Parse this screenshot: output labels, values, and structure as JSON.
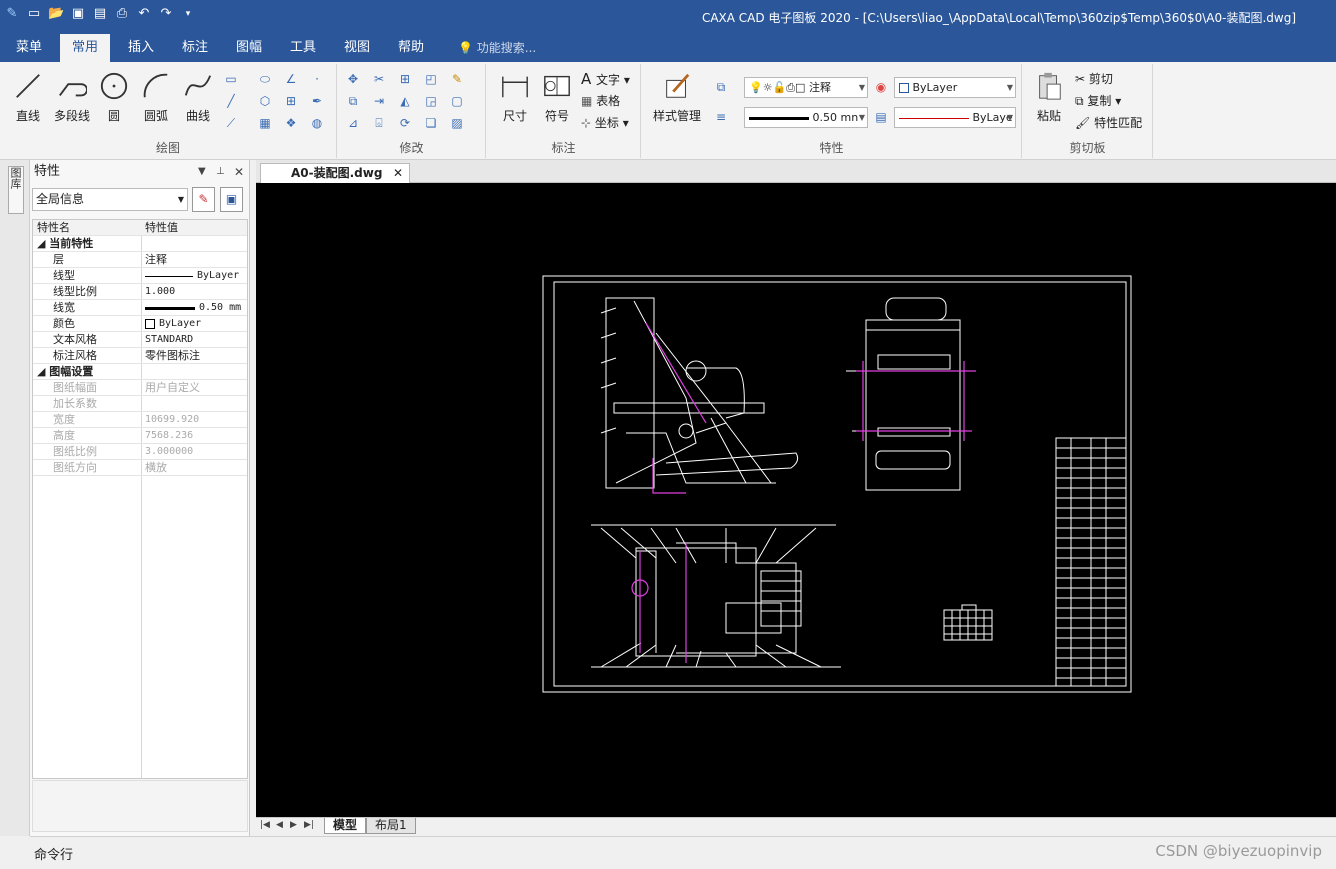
{
  "app": {
    "title": "CAXA CAD 电子图板 2020 - [C:\\Users\\liao_\\AppData\\Local\\Temp\\360zip$Temp\\360$0\\A0-装配图.dwg]"
  },
  "menu": {
    "tabs": [
      "菜单",
      "常用",
      "插入",
      "标注",
      "图幅",
      "工具",
      "视图",
      "帮助"
    ],
    "active": "常用",
    "search_placeholder": "功能搜索..."
  },
  "ribbon": {
    "draw": {
      "label": "绘图",
      "line": "直线",
      "polyline": "多段线",
      "circle": "圆",
      "arc": "圆弧",
      "curve": "曲线"
    },
    "modify": {
      "label": "修改"
    },
    "annotate": {
      "label": "标注",
      "dimension": "尺寸",
      "symbol": "符号",
      "text": "文字",
      "table": "表格",
      "coord": "坐标"
    },
    "properties": {
      "label": "特性",
      "style_manager": "样式管理",
      "layer_value": "注释",
      "color_value": "ByLayer",
      "lineweight_value": "0.50 mn",
      "linetype_value": "ByLaye"
    },
    "clipboard": {
      "label": "剪切板",
      "paste": "粘贴",
      "cut": "剪切",
      "copy": "复制",
      "match": "特性匹配"
    }
  },
  "side_tab": "图库",
  "panel": {
    "title": "特性",
    "scope": "全局信息",
    "header": {
      "name": "特性名",
      "value": "特性值"
    },
    "sections": [
      {
        "title": "当前特性",
        "rows": [
          {
            "name": "层",
            "value": "注释"
          },
          {
            "name": "线型",
            "value": "ByLayer"
          },
          {
            "name": "线型比例",
            "value": "1.000"
          },
          {
            "name": "线宽",
            "value": "0.50 mm"
          },
          {
            "name": "颜色",
            "value": "ByLayer"
          },
          {
            "name": "文本风格",
            "value": "STANDARD"
          },
          {
            "name": "标注风格",
            "value": "零件图标注"
          }
        ]
      },
      {
        "title": "图幅设置",
        "rows": [
          {
            "name": "图纸幅面",
            "value": "用户自定义"
          },
          {
            "name": "加长系数",
            "value": ""
          },
          {
            "name": "宽度",
            "value": "10699.920"
          },
          {
            "name": "高度",
            "value": "7568.236"
          },
          {
            "name": "图纸比例",
            "value": "3.000000"
          },
          {
            "name": "图纸方向",
            "value": "横放"
          }
        ]
      }
    ]
  },
  "doc_tab": "A0-装配图.dwg",
  "layout_tabs": [
    "模型",
    "布局1"
  ],
  "command_label": "命令行",
  "watermark": "CSDN @biyezuopinvip"
}
